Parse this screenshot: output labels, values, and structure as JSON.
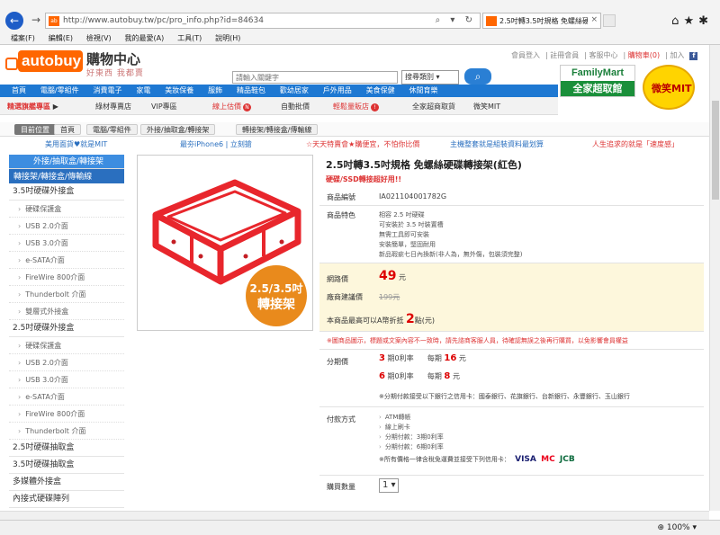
{
  "browser": {
    "url": "http://www.autobuy.tw/pc/pro_info.php?id=84634",
    "tab_title": "2.5吋轉3.5吋規格 免螺絲硬碟...",
    "tab_favicon": "autobuy-favicon",
    "menu": [
      "檔案(F)",
      "編輯(E)",
      "檢視(V)",
      "我的最愛(A)",
      "工具(T)",
      "說明(H)"
    ],
    "zoom": "100%"
  },
  "site": {
    "logo": "autobuy",
    "title": "購物中心",
    "slogan": "好東西 我都賣",
    "search_placeholder": "請輸入關鍵字",
    "search_select": "搜尋類別",
    "top_links": [
      "會員登入",
      "註冊會員",
      "客服中心",
      "購物車(0)",
      "加入"
    ],
    "familymart_top": "FamilyMart",
    "familymart_bottom": "全家超取館",
    "mit": "微笑MIT"
  },
  "nav": [
    "首頁",
    "電腦/零組件",
    "消費電子",
    "家電",
    "美妝保養",
    "服飾",
    "精品鞋包",
    "歡幼居家",
    "戶外用品",
    "美食保健",
    "休閒育樂"
  ],
  "subnav": {
    "hot_label": "精選旗艦專區",
    "items": [
      "綠材專賣店",
      "VIP專區",
      "線上估價",
      "自動批價",
      "輕鬆量販店",
      "全家超商取貨",
      "微笑MIT"
    ]
  },
  "breadcrumb": [
    "目前位置",
    "首頁",
    "電腦/零組件",
    "外接/抽取盒/轉接架",
    "轉接架/轉接盒/傳輸線"
  ],
  "promos": [
    "美用面貨♥就是MIT",
    "最夯iPhone6 | 立刻搶",
    "☆天天特賣會★購便宜，不怕你比價",
    "主機整套就是組裝資料最划算",
    "人生追求的就是「速度感」"
  ],
  "sidebar": {
    "head1": "外接/抽取盒/轉接架",
    "head2": "轉接架/轉接盒/傳輸線",
    "entries": [
      {
        "type": "cat",
        "label": "3.5吋硬碟外接盒"
      },
      {
        "type": "item",
        "label": "硬碟保護盒"
      },
      {
        "type": "item",
        "label": "USB 2.0介面"
      },
      {
        "type": "item",
        "label": "USB 3.0介面"
      },
      {
        "type": "item",
        "label": "e-SATA介面"
      },
      {
        "type": "item",
        "label": "FireWire 800介面"
      },
      {
        "type": "item",
        "label": "Thunderbolt 介面"
      },
      {
        "type": "item",
        "label": "雙層式外接盒"
      },
      {
        "type": "cat",
        "label": "2.5吋硬碟外接盒"
      },
      {
        "type": "item",
        "label": "硬碟保護盒"
      },
      {
        "type": "item",
        "label": "USB 2.0介面"
      },
      {
        "type": "item",
        "label": "USB 3.0介面"
      },
      {
        "type": "item",
        "label": "e-SATA介面"
      },
      {
        "type": "item",
        "label": "FireWire 800介面"
      },
      {
        "type": "item",
        "label": "Thunderbolt 介面"
      },
      {
        "type": "cat",
        "label": "2.5吋硬碟抽取盒"
      },
      {
        "type": "cat",
        "label": "3.5吋硬碟抽取盒"
      },
      {
        "type": "cat",
        "label": "多媒體外接盒"
      },
      {
        "type": "cat",
        "label": "內接式硬碟陣列"
      }
    ]
  },
  "product": {
    "badge_line1": "2.5/3.5吋",
    "badge_line2": "轉接架",
    "title": "2.5吋轉3.5吋規格 免螺絲硬碟轉接架(紅色)",
    "subtitle": "硬碟/SSD轉接超好用!!",
    "code_label": "商品編號",
    "code": "IA021104001782G",
    "feature_label": "商品特色",
    "features": [
      "相容 2.5 吋硬碟",
      "可安裝於 3.5 吋裝置槽",
      "無需工具即可安裝",
      "安裝簡單，堅固耐用",
      "新品瑕疵七日內換新(非人為，無外傷，包裝須完整)"
    ],
    "price_label": "網路價",
    "price": "49",
    "price_unit": "元",
    "list_label": "廠商建議價",
    "list_price": "199元",
    "points_text": "本商品最高可以A幣折抵",
    "points": "2",
    "points_unit": "點(元)",
    "notice": "※圖商品圖示，標題或文案內容不一致時，請先諮商客服人員，待確認無誤之後再行購買，以免影響會員權益",
    "installment_label": "分期價",
    "inst1_n": "3",
    "inst1_text": "期0利率",
    "inst1_per": "每期",
    "inst1_amt": "16",
    "inst1_unit": "元",
    "inst2_n": "6",
    "inst2_text": "期0利率",
    "inst2_per": "每期",
    "inst2_amt": "8",
    "inst2_unit": "元",
    "inst_banks": "※分期付款接受以下銀行之信用卡：國泰銀行、花旗銀行、台新銀行、永豐銀行、玉山銀行",
    "payment_label": "付款方式",
    "payments": [
      "ATM轉帳",
      "線上刷卡",
      "分期付款：3期0利率",
      "分期付款：6期0利率"
    ],
    "card_note": "※所有價格一律含稅免運費並接受下列信用卡：",
    "cards": [
      "VISA",
      "MC",
      "JCB"
    ],
    "qty_label": "購買數量",
    "qty": "1"
  },
  "colors": {
    "brand": "#ff6600",
    "nav": "#1e78d2",
    "price": "#dd0000",
    "fm_green": "#1a8f3a"
  }
}
